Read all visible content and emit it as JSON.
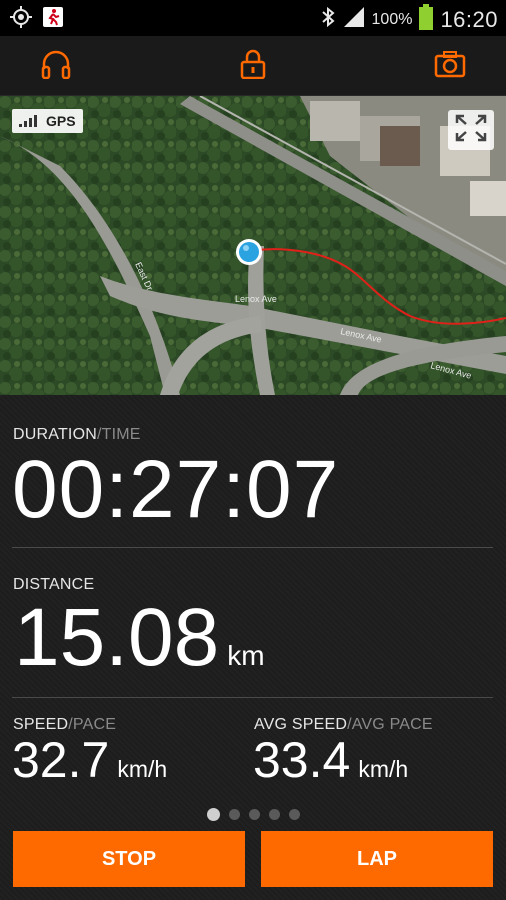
{
  "status_bar": {
    "battery_percent": "100%",
    "clock": "16:20",
    "icons": [
      "gps-target-icon",
      "runner-notification-icon",
      "bluetooth-icon",
      "signal-icon",
      "battery-icon"
    ]
  },
  "toolbar": {
    "icons": [
      "headphones-icon",
      "lock-icon",
      "camera-icon"
    ],
    "accent": "#ff6a00"
  },
  "map": {
    "gps_label": "GPS",
    "street_labels": [
      "Lenox Ave",
      "Lenox Ave",
      "Lenox Ave",
      "East Dr"
    ]
  },
  "stats": {
    "duration": {
      "label": "DURATION",
      "alt_label": "/TIME",
      "value": "00:27:07"
    },
    "distance": {
      "label": "DISTANCE",
      "value": "15.08",
      "unit": "km"
    },
    "speed": {
      "label": "SPEED",
      "alt_label": "/PACE",
      "value": "32.7",
      "unit": "km/h"
    },
    "avg_speed": {
      "label": "AVG SPEED",
      "alt_label": "/AVG PACE",
      "value": "33.4",
      "unit": "km/h"
    }
  },
  "pager": {
    "page_count": 5,
    "active_index": 0
  },
  "actions": {
    "stop_label": "STOP",
    "lap_label": "LAP"
  }
}
